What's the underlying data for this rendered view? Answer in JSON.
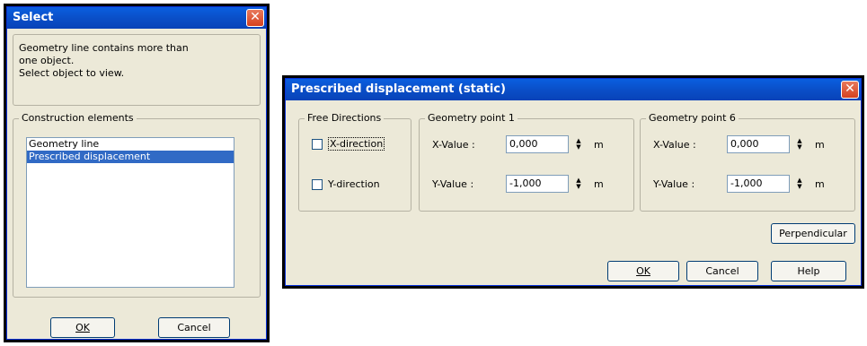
{
  "select_dialog": {
    "title": "Select",
    "message_line1": "Geometry line contains more than",
    "message_line2": "one object.",
    "message_line3": "Select object to view.",
    "group_label": "Construction elements",
    "items": [
      "Geometry line",
      "Prescribed displacement"
    ],
    "ok_label": "OK",
    "cancel_label": "Cancel"
  },
  "displacement_dialog": {
    "title": "Prescribed displacement (static)",
    "free_directions": {
      "label": "Free Directions",
      "x_label": "X-direction",
      "y_label": "Y-direction"
    },
    "point1": {
      "label": "Geometry point 1",
      "x_label": "X-Value :",
      "x_value": "0,000",
      "y_label": "Y-Value :",
      "y_value": "-1,000",
      "unit": "m"
    },
    "point6": {
      "label": "Geometry point 6",
      "x_label": "X-Value :",
      "x_value": "0,000",
      "y_label": "Y-Value :",
      "y_value": "-1,000",
      "unit": "m"
    },
    "perpendicular_label": "Perpendicular",
    "ok_label": "OK",
    "cancel_label": "Cancel",
    "help_label": "Help"
  },
  "colors": {
    "titlebar": "#0a4fc8",
    "dialog_face": "#ece9d8",
    "selection": "#316ac5",
    "close": "#d5411f"
  }
}
